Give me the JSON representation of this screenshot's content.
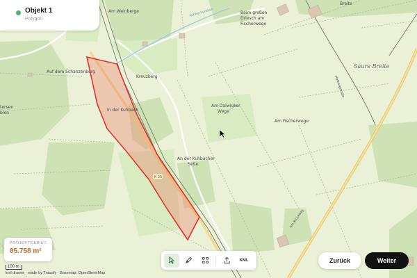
{
  "object": {
    "title": "Objekt 1",
    "subtitle": "Polygon",
    "status_color": "#49b66b"
  },
  "map": {
    "labels": {
      "am_weinberge": "Am Weinberge",
      "beim_grossen_driesch": "Beim großen",
      "beim_grossen_driesch_2": "Driesch am",
      "beim_grossen_driesch_3": "Fischerwege",
      "breite": "Breite",
      "auf_dem_schanzenberg": "Auf dem Schanzenberg",
      "kreuzberg": "Kreuzberg",
      "saure_breite": "Saure Breite",
      "in_der_kuhbach": "In der Kuhbach",
      "am_dalwigker_wege": "Am Dalwigker",
      "am_dalwigker_wege_2": "Wege",
      "am_fischerwege": "Am Fischerwege",
      "an_der_kuhbacher_seite": "An der Kuhbacher",
      "an_der_kuhbacher_seite_2": "Seite",
      "road_k25": "K 25",
      "hofbergstrasse": "Hofbergstraße",
      "kuhbachgraben": "Kuhbachgraben",
      "bruckweg": "Am Brückweg",
      "left_edge_1": "tersen",
      "left_edge_2": "blen"
    },
    "polygon_color": "#e3312f",
    "polygon_fill": "rgba(235,120,100,0.35)"
  },
  "project_area": {
    "label": "PROJEKTGEBIET",
    "value": "85.758 m²",
    "value_color": "#c0672a"
  },
  "scale_label": "100 m",
  "attribution": "kml drawer · made by Trassify · Basemap: OpenStreetMap",
  "toolbar": {
    "tools": [
      "select-icon",
      "draw-icon",
      "nodes-icon",
      "upload-icon"
    ],
    "kml_label": "KML"
  },
  "buttons": {
    "back_label": "Zurück",
    "next_label": "Weiter"
  }
}
